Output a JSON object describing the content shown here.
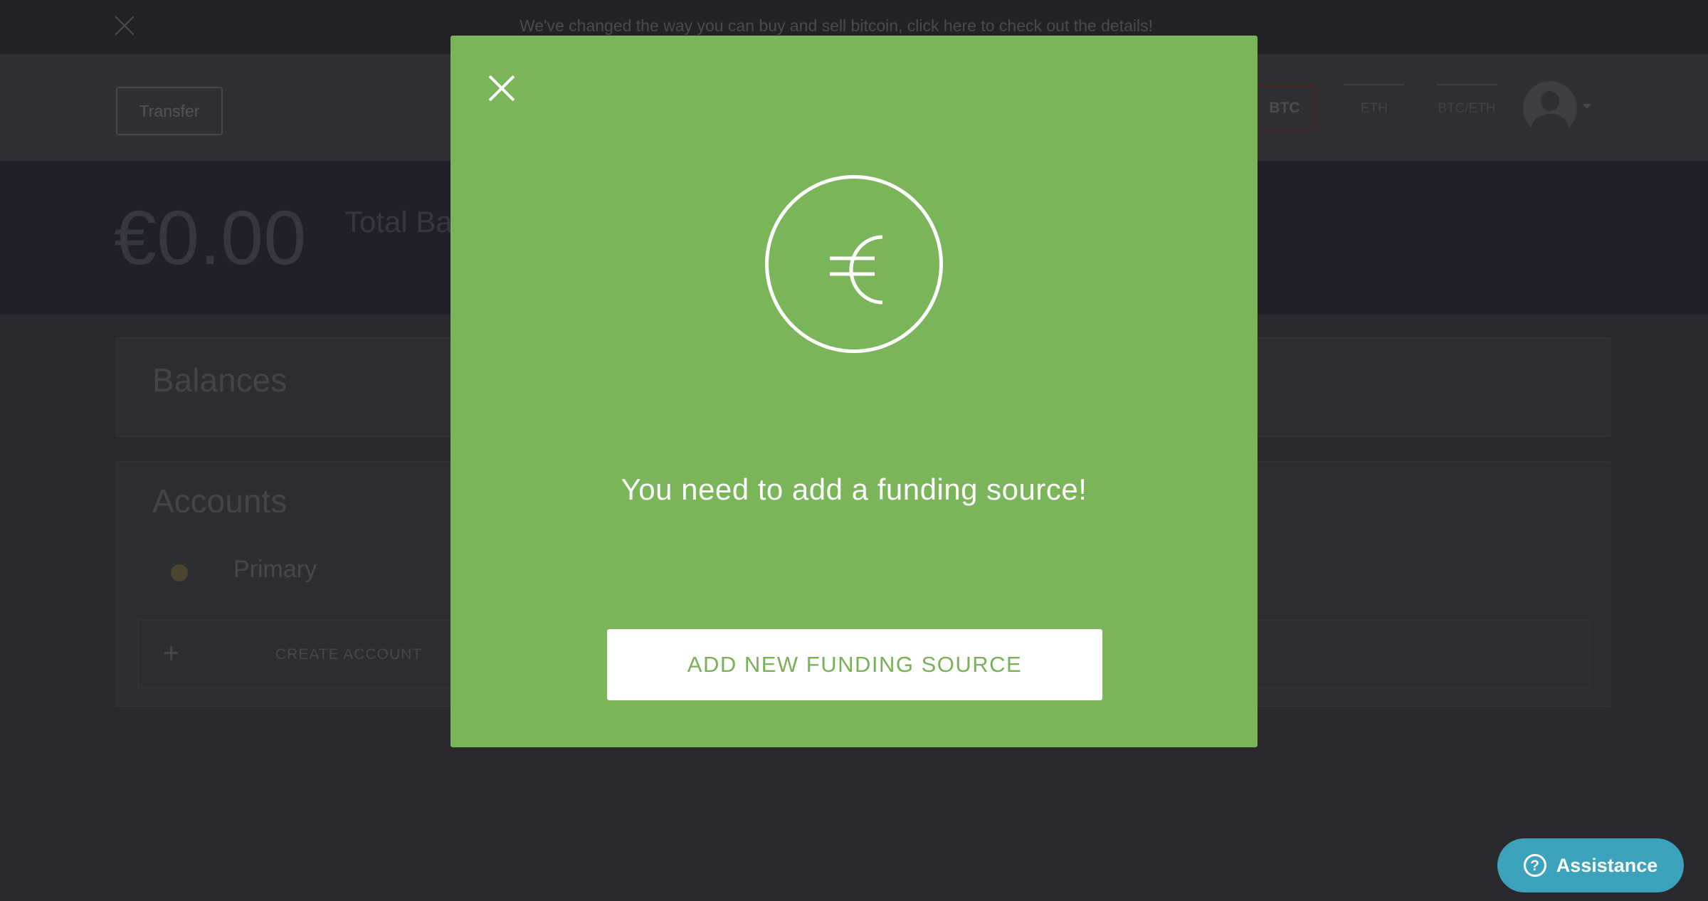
{
  "announcement": {
    "text": "We've changed the way you can buy and sell bitcoin, click here to check out the details!"
  },
  "nav": {
    "transfer_label": "Transfer",
    "btc_label": "BTC",
    "tab_eth": "ETH",
    "tab_other": "BTC/ETH"
  },
  "balance": {
    "amount": "€0.00",
    "label": "Total Balance"
  },
  "balances_card": {
    "title": "Balances"
  },
  "accounts_card": {
    "title": "Accounts",
    "primary_name": "Primary",
    "create_plus": "+",
    "create_label": "CREATE ACCOUNT"
  },
  "modal": {
    "icon": "euro-icon",
    "message": "You need to add a funding source!",
    "cta_label": "ADD NEW FUNDING SOURCE"
  },
  "assistance": {
    "icon_glyph": "?",
    "label": "Assistance"
  },
  "colors": {
    "modal_green": "#7ab55a",
    "assist_teal": "#3ca3bd",
    "overlay_dark": "#292a2d"
  }
}
